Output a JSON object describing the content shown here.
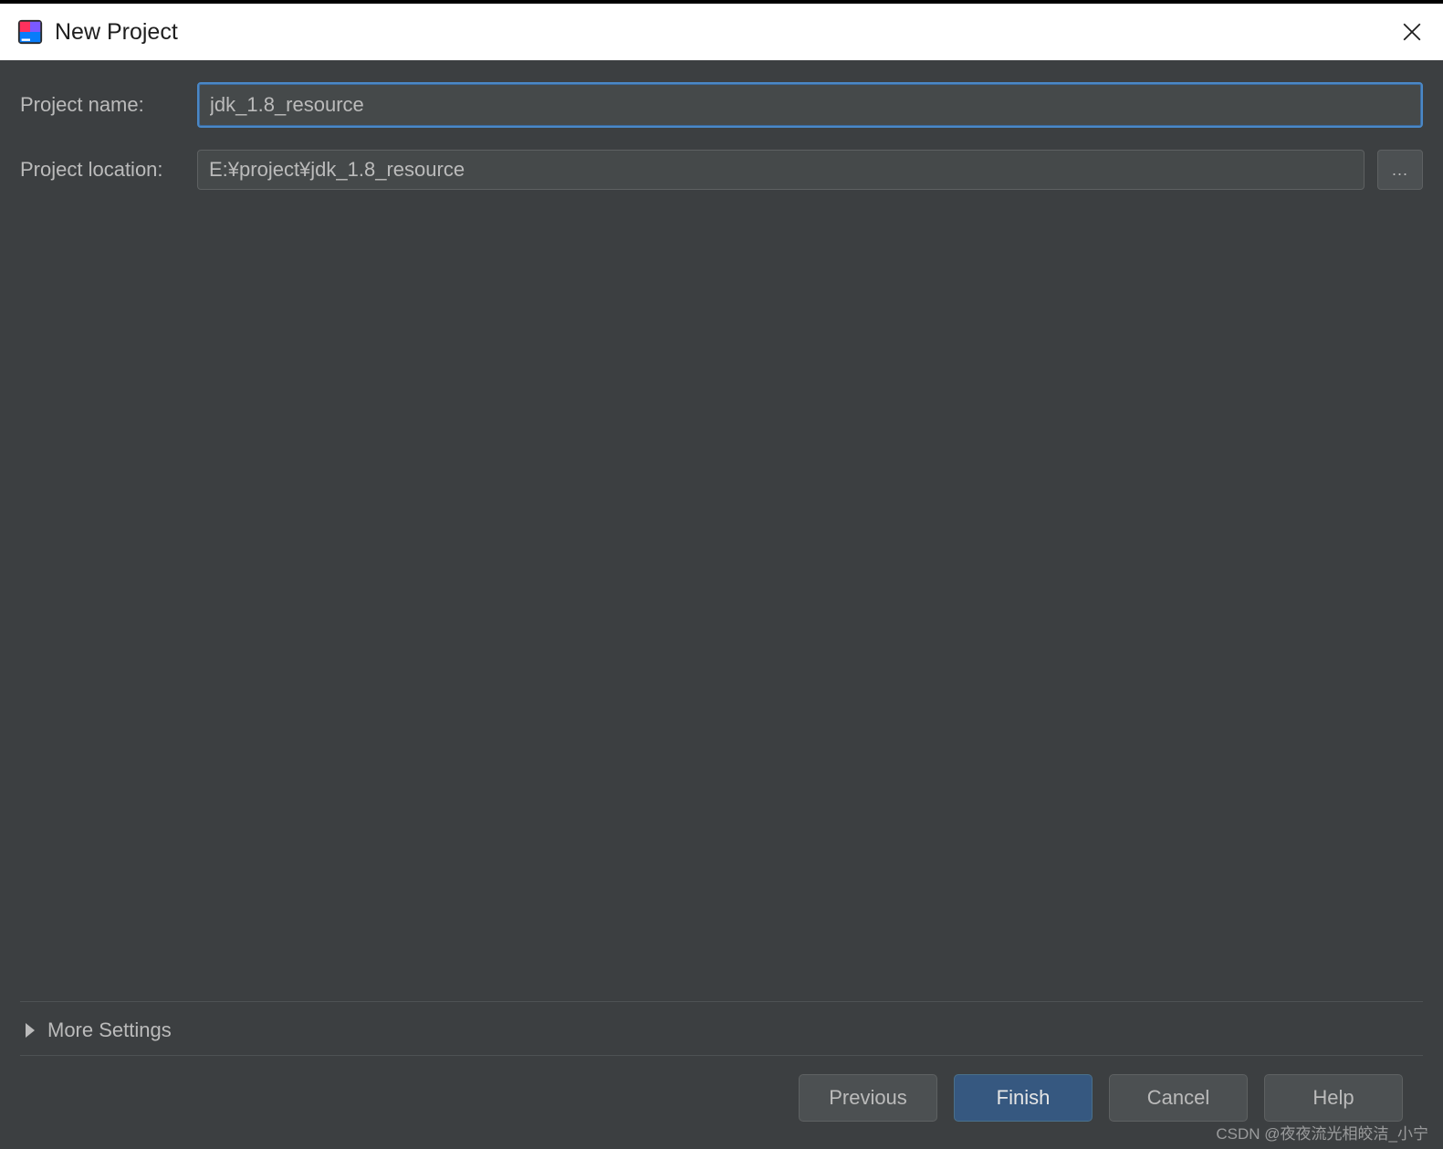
{
  "titlebar": {
    "title": "New Project",
    "app_icon": "intellij-icon",
    "close_icon": "close-icon"
  },
  "form": {
    "name_label": "Project name:",
    "name_value": "jdk_1.8_resource",
    "location_label": "Project location:",
    "location_value": "E:¥project¥jdk_1.8_resource",
    "browse_label": "..."
  },
  "more_settings": {
    "label": "More Settings",
    "expanded": false
  },
  "buttons": {
    "previous": "Previous",
    "finish": "Finish",
    "cancel": "Cancel",
    "help": "Help"
  },
  "watermark": "CSDN @夜夜流光相皎洁_小宁",
  "colors": {
    "bg": "#3c3f41",
    "input_bg": "#45494a",
    "focus_border": "#4a88c7",
    "primary_btn": "#365880",
    "text": "#bbbbbb"
  }
}
